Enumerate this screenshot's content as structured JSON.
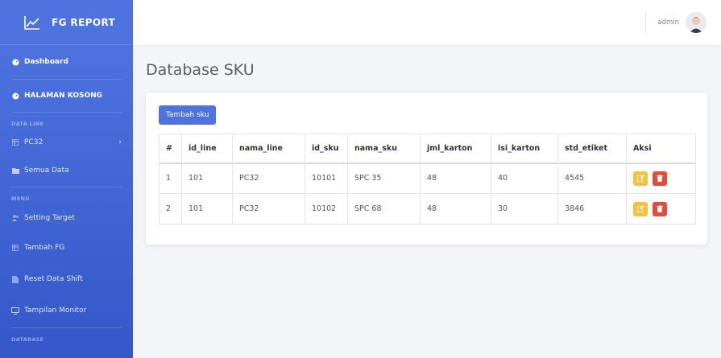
{
  "brand": {
    "name": "FG REPORT"
  },
  "sidebar": {
    "items": [
      {
        "label": "Dashboard"
      },
      {
        "label": "HALAMAN KOSONG"
      },
      {
        "label": "PC32"
      },
      {
        "label": "Semua Data"
      },
      {
        "label": "Setting Target"
      },
      {
        "label": "Tambah FG"
      },
      {
        "label": "Reset Data Shift"
      },
      {
        "label": "Tampilan Monitor"
      }
    ],
    "headings": [
      "DATA LINE",
      "MENU",
      "DATABASE"
    ]
  },
  "topbar": {
    "user": "admin"
  },
  "page": {
    "title": "Database SKU"
  },
  "toolbar": {
    "add_label": "Tambah sku"
  },
  "table": {
    "headers": [
      "#",
      "id_line",
      "nama_line",
      "id_sku",
      "nama_sku",
      "jml_karton",
      "isi_karton",
      "std_etiket",
      "Aksi"
    ],
    "rows": [
      [
        "1",
        "101",
        "PC32",
        "10101",
        "SPC 35",
        "48",
        "40",
        "4545"
      ],
      [
        "2",
        "101",
        "PC32",
        "10102",
        "SPC 68",
        "48",
        "30",
        "3846"
      ]
    ]
  },
  "colors": {
    "primary": "#4e73df",
    "warning": "#f6c23e",
    "danger": "#e74a3b"
  }
}
